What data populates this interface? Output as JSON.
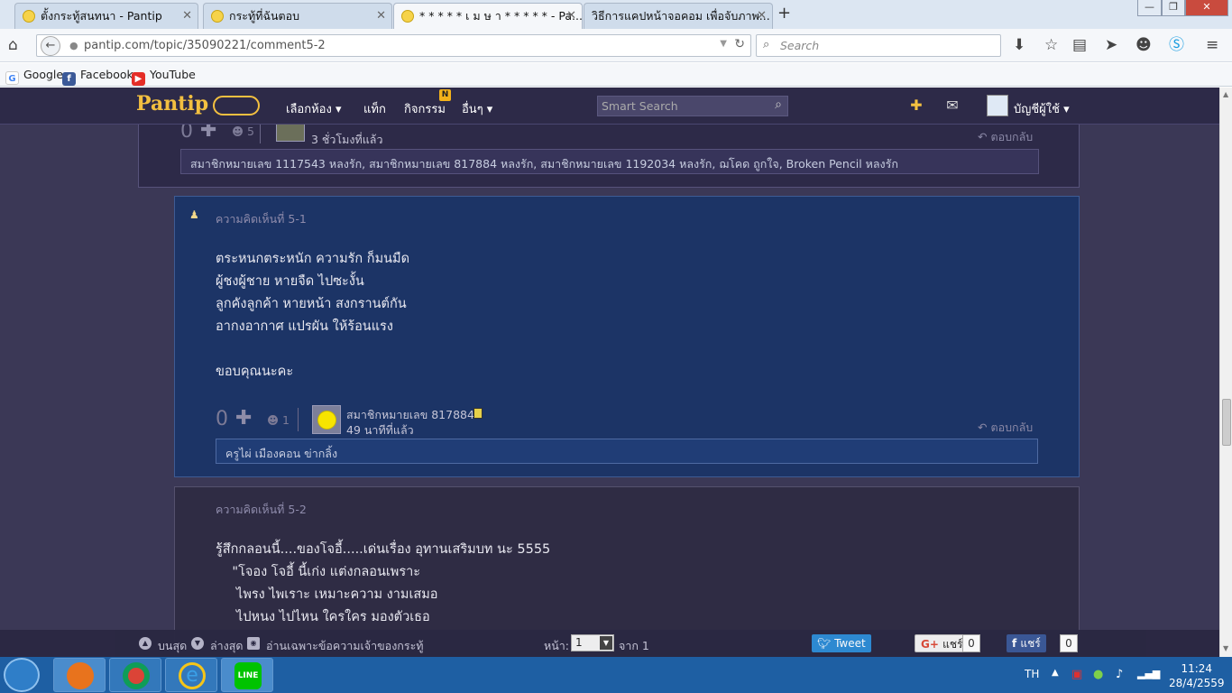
{
  "browser": {
    "tabs": [
      {
        "label": "ตั้งกระทู้สนทนา - Pantip",
        "active": false
      },
      {
        "label": "กระทู้ที่ฉันตอบ",
        "active": false
      },
      {
        "label": "* * * * * เ ม ษ า * * * * * - Pa...",
        "active": true
      },
      {
        "label": "วิธีการแคปหน้าจอคอม เพื่อจับภาพ...",
        "active": false
      }
    ],
    "url": "pantip.com/topic/35090221/comment5-2",
    "search_placeholder": "Search",
    "bookmarks": [
      "Google",
      "Facebook",
      "YouTube"
    ]
  },
  "site": {
    "logo": "Pantip",
    "nav": [
      "เลือกห้อง ▾",
      "แท็ก",
      "กิจกรรม",
      "อื่นๆ ▾"
    ],
    "nav_badge": "N",
    "smart_search_placeholder": "Smart Search",
    "account_label": "บัญชีผู้ใช้ ▾"
  },
  "prev_comment": {
    "votes": "0",
    "emotions": "5",
    "time": "3 ชั่วโมงที่แล้ว",
    "reply": "ตอบกลับ",
    "likes": "สมาชิกหมายเลข 1117543 หลงรัก, สมาชิกหมายเลข 817884 หลงรัก, สมาชิกหมายเลข 1192034 หลงรัก, ฌโคด ถูกใจ, Broken Pencil หลงรัก"
  },
  "comment_5_1": {
    "label": "ความคิดเห็นที่ 5-1",
    "text": "ตระหนกตระหนัก ความรัก ก็มนมืด\nผู้ชงผู้ชาย หายจืด ไปซะงั้น\nลูกคังลูกค้า หายหน้า สงกรานต์กัน\nอากงอากาศ แปรผัน ให้ร้อนแรง\n\nขอบคุณนะคะ",
    "votes": "0",
    "emotions": "1",
    "user": "สมาชิกหมายเลข 817884",
    "time": "49 นาทีที่แล้ว",
    "reply": "ตอบกลับ",
    "likes": "ครูไผ่ เมืองคอน ข่ากลิ้ง"
  },
  "comment_5_2": {
    "label": "ความคิดเห็นที่ 5-2",
    "text": "รู้สึกกลอนนี้....ของโจอี้.....เด่นเรื่อง อุทานเสริมบท นะ 5555\n    \"โจอง โจอี้ นี้เก่ง แต่งกลอนเพราะ\n     ไพรง ไพเราะ เหมาะความ งามเสมอ\n     ไปหนง ไปไหน ใครใคร มองตัวเธอ"
  },
  "bottom_bar": {
    "top": "บนสุด",
    "bottom": "ล่างสุด",
    "owner_only": "อ่านเฉพาะข้อความเจ้าของกระทู้",
    "page_label": "หน้า:",
    "page_value": "1",
    "of_label": "จาก 1",
    "tweet": "Tweet",
    "gplus_share": "แชร์",
    "gplus_count": "0",
    "fb_share": "แชร์",
    "fb_count": "0"
  },
  "taskbar": {
    "lang": "TH",
    "time": "11:24",
    "date": "28/4/2559",
    "line_label": "LINE"
  },
  "colors": {
    "page_bg": "#3b3856",
    "nav_bg": "#2d2a48",
    "logo": "#f3c040",
    "comment_highlight": "#1c3466"
  }
}
